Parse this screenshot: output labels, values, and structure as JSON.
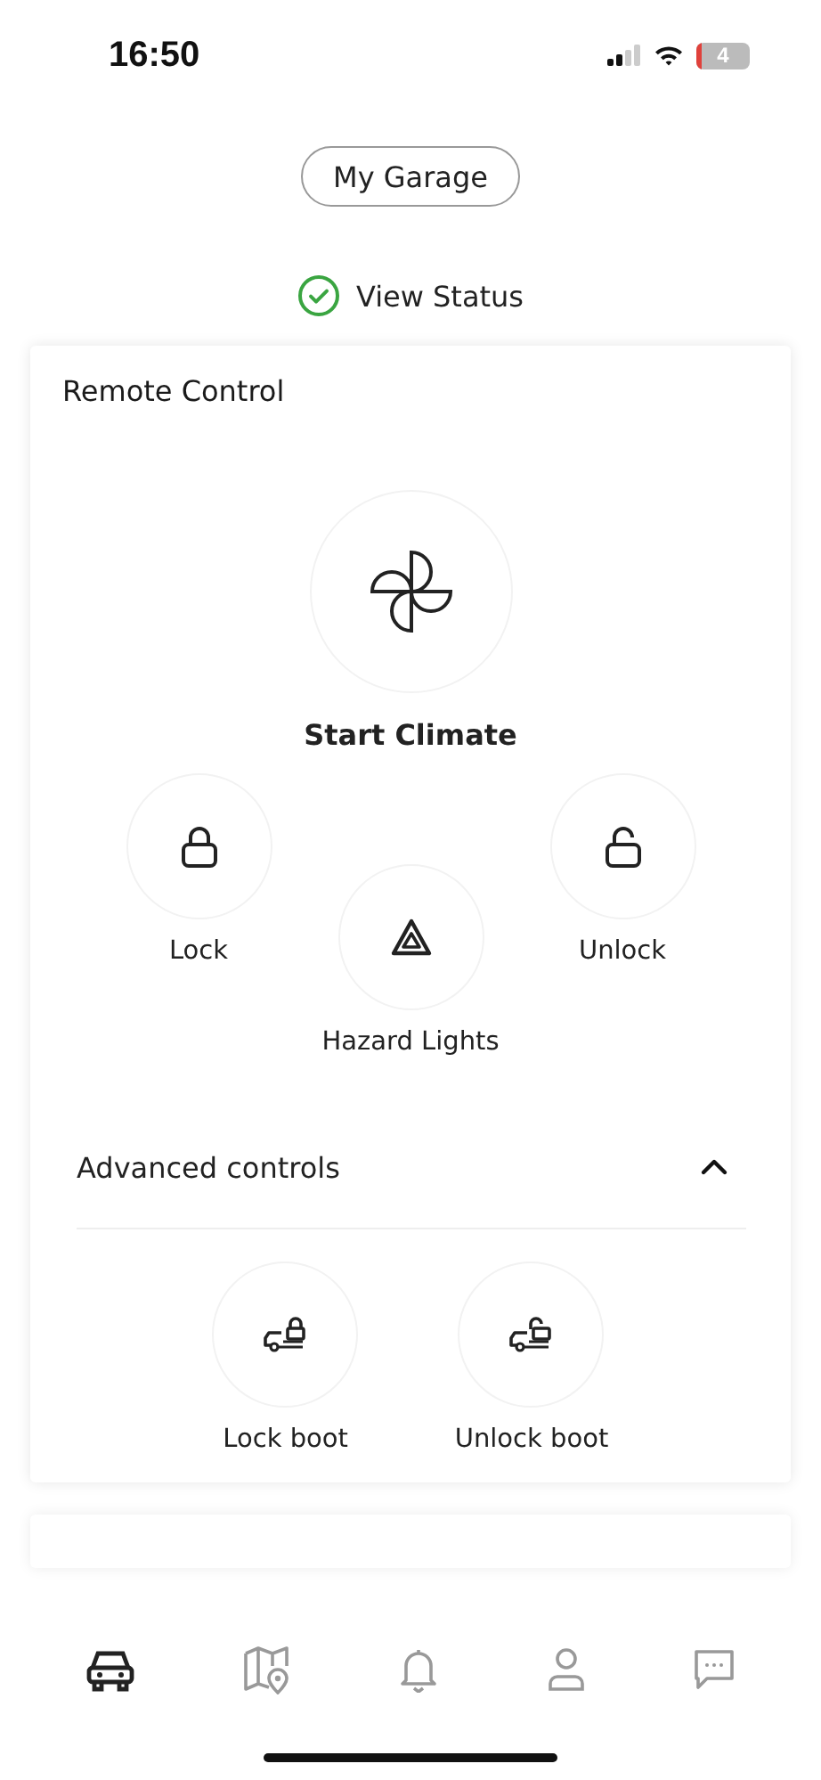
{
  "status_bar": {
    "time": "16:50",
    "battery": "4"
  },
  "garage_button": {
    "label": "My Garage"
  },
  "view_status": {
    "label": "View Status"
  },
  "remote_control": {
    "title": "Remote Control",
    "primary": {
      "kind": "fan",
      "label": "Start Climate"
    },
    "controls": [
      {
        "kind": "lock",
        "label": "Lock"
      },
      {
        "kind": "hazard",
        "label": "Hazard Lights"
      },
      {
        "kind": "unlock",
        "label": "Unlock"
      }
    ],
    "advanced": {
      "title": "Advanced controls",
      "expanded": true,
      "controls": [
        {
          "kind": "lock_boot",
          "label": "Lock boot"
        },
        {
          "kind": "unlock_boot",
          "label": "Unlock boot"
        }
      ]
    }
  },
  "tab_bar": [
    {
      "kind": "car",
      "selected": true
    },
    {
      "kind": "map",
      "selected": false
    },
    {
      "kind": "bell",
      "selected": false
    },
    {
      "kind": "person",
      "selected": false
    },
    {
      "kind": "chat",
      "selected": false
    }
  ]
}
